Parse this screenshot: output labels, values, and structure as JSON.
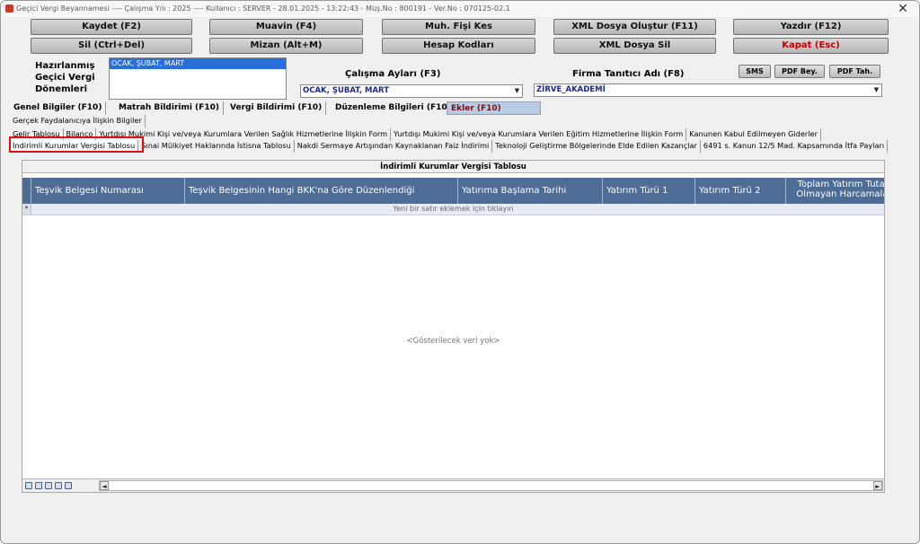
{
  "window": {
    "title": "Geçici Vergi Beyannamesi  ----  Çalışma Yılı : 2025  ----  Kullanıcı : SERVER - 28.01.2025 - 13:22:43 - Müş.No : 800191 - Ver.No : 070125-02.1",
    "close_glyph": "✕"
  },
  "toolbar": {
    "row1": [
      "Kaydet (F2)",
      "Muavin (F4)",
      "Muh. Fişi Kes",
      "XML Dosya Oluştur (F11)",
      "Yazdır (F12)"
    ],
    "row2": [
      "Sil (Ctrl+Del)",
      "Mizan (Alt+M)",
      "Hesap Kodları",
      "XML Dosya Sil",
      "Kapat (Esc)"
    ]
  },
  "periods": {
    "label": "Hazırlanmış Geçici Vergi Dönemleri",
    "label_lines": [
      "Hazırlanmış",
      "Geçici Vergi",
      "Dönemleri"
    ],
    "items": [
      "OCAK, ŞUBAT, MART"
    ]
  },
  "work_months": {
    "label": "Çalışma Ayları (F3)",
    "value": "OCAK, ŞUBAT, MART"
  },
  "firm": {
    "label": "Firma Tanıtıcı Adı (F8)",
    "value": "ZİRVE_AKADEMİ"
  },
  "side_buttons": [
    "SMS",
    "PDF Bey.",
    "PDF Tah."
  ],
  "main_tabs": [
    {
      "label": "Genel Bilgiler (F10)",
      "active": false
    },
    {
      "label": "Matrah Bildirimi (F10)",
      "active": false
    },
    {
      "label": "Vergi Bildirimi (F10)",
      "active": false
    },
    {
      "label": "Düzenleme Bilgileri (F10)",
      "active": false
    },
    {
      "label": "Ekler (F10)",
      "active": true
    }
  ],
  "sub_tabs": {
    "row1": [
      "Gerçek Faydalanıcıya İlişkin Bilgiler"
    ],
    "row2": [
      "Gelir Tablosu",
      "Bilanço",
      "Yurtdışı Mukimi Kişi ve/veya Kurumlara Verilen Sağlık Hizmetlerine İlişkin Form",
      "Yurtdışı Mukimi Kişi ve/veya Kurumlara Verilen Eğitim Hizmetlerine İlişkin Form",
      "Kanunen Kabul Edilmeyen Giderler"
    ],
    "row3": [
      "İndirimli Kurumlar Vergisi Tablosu",
      "Sınai Mülkiyet Haklarında İstisna Tablosu",
      "Nakdi Sermaye Artışından Kaynaklanan Faiz İndirimi",
      "Teknoloji Geliştirme Bölgelerinde Elde Edilen Kazançlar",
      "6491 s. Kanun 12/5 Mad. Kapsamında İtfa Payları"
    ]
  },
  "table": {
    "title": "İndirimli Kurumlar Vergisi Tablosu",
    "columns": [
      "Teşvik Belgesi Numarası",
      "Teşvik Belgesinin Hangi BKK'na Göre Düzenlendiği",
      "Yatırıma Başlama Tarihi",
      "Yatırım Türü 1",
      "Yatırım Türü 2",
      "Toplam Yatırım Tutarı",
      "Olmayan Harcamalar"
    ],
    "new_row_text": "Yeni bir satır eklemek için tıklayın",
    "new_row_marker": "*",
    "empty_text": "<Gösterilecek veri yok>"
  },
  "statusbar": {
    "icons": [
      "save-icon",
      "view-icon",
      "find-icon",
      "export-icon",
      "print-icon"
    ],
    "scroll_left": "◄",
    "scroll_right": "►"
  }
}
